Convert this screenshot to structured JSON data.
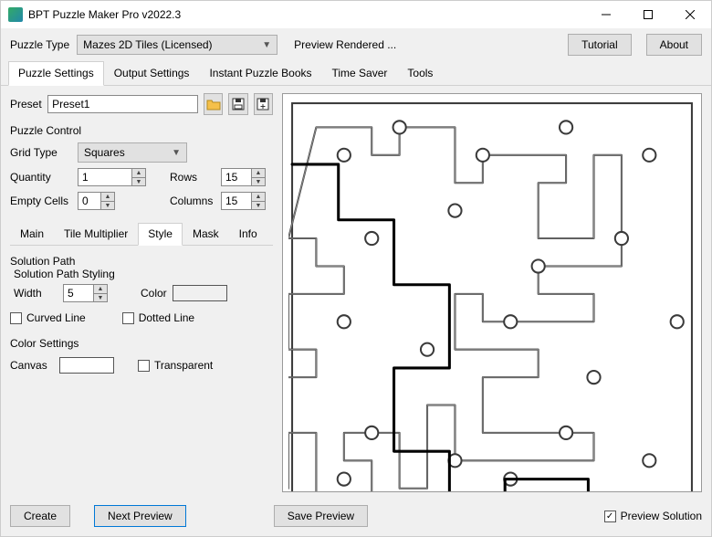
{
  "window": {
    "title": "BPT Puzzle Maker Pro v2022.3"
  },
  "toprow": {
    "puzzle_type_label": "Puzzle Type",
    "puzzle_type_value": "Mazes 2D Tiles (Licensed)",
    "status": "Preview Rendered ...",
    "tutorial": "Tutorial",
    "about": "About"
  },
  "tabs": {
    "items": [
      {
        "label": "Puzzle Settings"
      },
      {
        "label": "Output Settings"
      },
      {
        "label": "Instant Puzzle Books"
      },
      {
        "label": "Time Saver"
      },
      {
        "label": "Tools"
      }
    ]
  },
  "preset": {
    "label": "Preset",
    "value": "Preset1"
  },
  "control": {
    "group": "Puzzle Control",
    "grid_type_label": "Grid Type",
    "grid_type_value": "Squares",
    "quantity_label": "Quantity",
    "quantity_value": "1",
    "rows_label": "Rows",
    "rows_value": "15",
    "empty_label": "Empty Cells",
    "empty_value": "0",
    "columns_label": "Columns",
    "columns_value": "15"
  },
  "subtabs": {
    "items": [
      {
        "label": "Main"
      },
      {
        "label": "Tile Multiplier"
      },
      {
        "label": "Style"
      },
      {
        "label": "Mask"
      },
      {
        "label": "Info"
      }
    ]
  },
  "style": {
    "solution_path": "Solution Path",
    "styling": "Solution Path Styling",
    "width_label": "Width",
    "width_value": "5",
    "color_label": "Color",
    "color_value": "#000000",
    "curved": "Curved Line",
    "dotted": "Dotted Line",
    "color_settings": "Color Settings",
    "canvas_label": "Canvas",
    "canvas_value": "#ffffff",
    "transparent": "Transparent"
  },
  "bottom": {
    "create": "Create",
    "next": "Next Preview",
    "save": "Save Preview",
    "preview_solution": "Preview Solution",
    "preview_solution_checked": true
  }
}
